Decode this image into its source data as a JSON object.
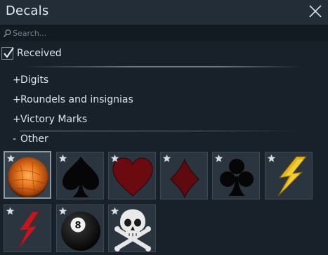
{
  "window": {
    "title": "Decals",
    "close_icon": "close-icon"
  },
  "search": {
    "placeholder": "Search...",
    "value": ""
  },
  "filter": {
    "received_label": "Received",
    "received_checked": true
  },
  "categories": [
    {
      "sign": "+",
      "label": "Digits",
      "expanded": false
    },
    {
      "sign": "+",
      "label": "Roundels and insignias",
      "expanded": false
    },
    {
      "sign": "+",
      "label": "Victory Marks",
      "expanded": false
    },
    {
      "sign": "-",
      "label": "Other",
      "expanded": true
    }
  ],
  "decals": [
    {
      "name": "orange-sphere-decal",
      "selected": true,
      "starred": true
    },
    {
      "name": "spade-decal",
      "selected": false,
      "starred": true
    },
    {
      "name": "heart-decal",
      "selected": false,
      "starred": true
    },
    {
      "name": "diamond-decal",
      "selected": false,
      "starred": true
    },
    {
      "name": "club-decal",
      "selected": false,
      "starred": true
    },
    {
      "name": "yellow-lightning-decal",
      "selected": false,
      "starred": true
    },
    {
      "name": "red-lightning-decal",
      "selected": false,
      "starred": true
    },
    {
      "name": "eight-ball-decal",
      "selected": false,
      "starred": true
    },
    {
      "name": "skull-crossbones-decal",
      "selected": false,
      "starred": true
    }
  ],
  "colors": {
    "header_bg": "#222d38",
    "body_bg": "#18212a",
    "tile_bg": "#2b3540",
    "star": "#d8dde2"
  }
}
